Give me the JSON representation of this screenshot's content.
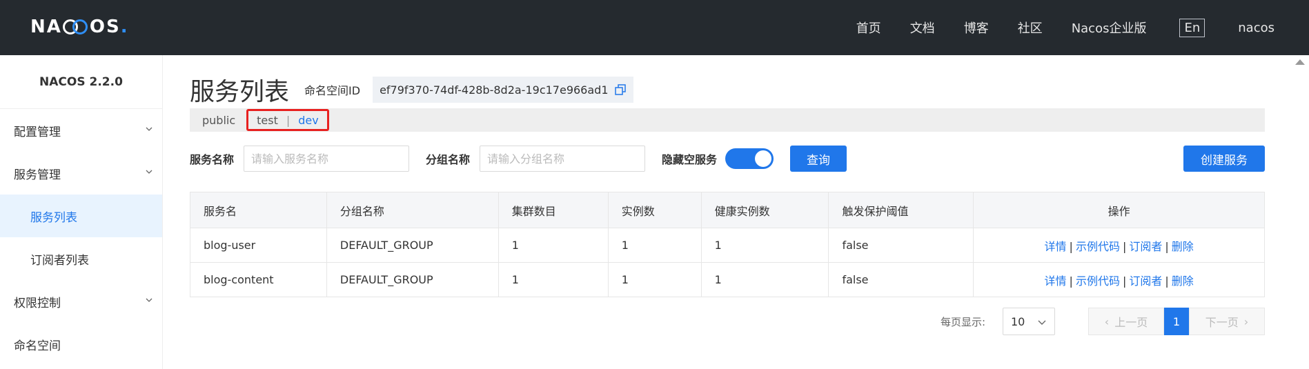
{
  "header": {
    "logo": {
      "prefix": "NA",
      "suffix": "OS",
      "dot": "."
    },
    "nav": [
      "首页",
      "文档",
      "博客",
      "社区",
      "Nacos企业版"
    ],
    "lang": "En",
    "user": "nacos"
  },
  "sidebar": {
    "version": "NACOS 2.2.0",
    "items": [
      {
        "label": "配置管理",
        "icon": "chevron-down-icon"
      },
      {
        "label": "服务管理",
        "icon": "chevron-down-icon"
      },
      {
        "label": "服务列表",
        "active": true
      },
      {
        "label": "订阅者列表"
      },
      {
        "label": "权限控制",
        "icon": "chevron-down-icon"
      },
      {
        "label": "命名空间"
      }
    ]
  },
  "main": {
    "title": "服务列表",
    "namespace_label": "命名空间ID",
    "namespace_id": "ef79f370-74df-428b-8d2a-19c17e966ad1",
    "namespaces": {
      "public": "public",
      "test": "test",
      "sep": "|",
      "dev": "dev"
    },
    "search": {
      "service_label": "服务名称",
      "service_placeholder": "请输入服务名称",
      "group_label": "分组名称",
      "group_placeholder": "请输入分组名称",
      "hide_empty_label": "隐藏空服务",
      "hide_empty_on": true,
      "query_button": "查询",
      "create_button": "创建服务"
    },
    "table": {
      "columns": [
        "服务名",
        "分组名称",
        "集群数目",
        "实例数",
        "健康实例数",
        "触发保护阈值",
        "操作"
      ],
      "rows": [
        {
          "name": "blog-user",
          "group": "DEFAULT_GROUP",
          "clusters": "1",
          "instances": "1",
          "healthy": "1",
          "threshold": "false"
        },
        {
          "name": "blog-content",
          "group": "DEFAULT_GROUP",
          "clusters": "1",
          "instances": "1",
          "healthy": "1",
          "threshold": "false"
        }
      ],
      "ops": {
        "detail": "详情",
        "sample": "示例代码",
        "subscribers": "订阅者",
        "delete": "删除",
        "sep": "|"
      }
    },
    "pagination": {
      "page_size_label": "每页显示:",
      "page_size": "10",
      "prev": "上一页",
      "current": "1",
      "next": "下一页"
    }
  },
  "colors": {
    "primary": "#2077ea",
    "header_bg": "#252a2f",
    "highlight": "#e8201f"
  }
}
